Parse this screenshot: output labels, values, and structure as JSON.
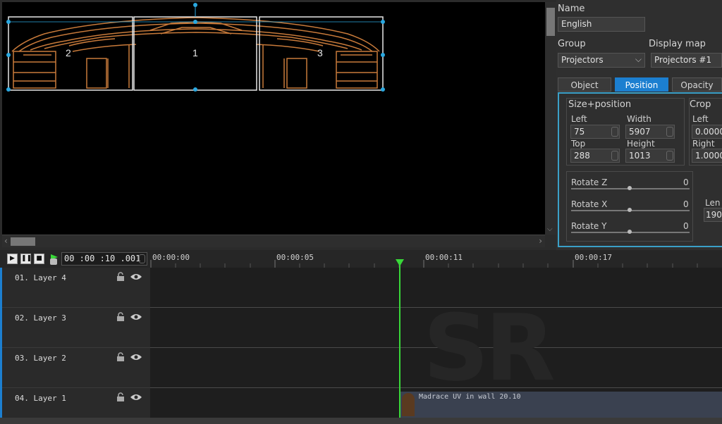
{
  "viewport": {
    "projector_labels": [
      "2",
      "1",
      "3"
    ]
  },
  "properties": {
    "name_label": "Name",
    "name_value": "English",
    "group_label": "Group",
    "group_value": "Projectors",
    "display_map_label": "Display map",
    "display_map_value": "Projectors #1",
    "tabs": [
      {
        "label": "Object",
        "active": false
      },
      {
        "label": "Position",
        "active": true
      },
      {
        "label": "Opacity",
        "active": false
      }
    ],
    "size_position": {
      "title": "Size+position",
      "left_label": "Left",
      "left_value": "75",
      "width_label": "Width",
      "width_value": "5907",
      "top_label": "Top",
      "top_value": "288",
      "height_label": "Height",
      "height_value": "1013"
    },
    "crop": {
      "title": "Crop",
      "left_label": "Left",
      "left_value": "0.0000",
      "right_label": "Right",
      "right_value": "1.0000"
    },
    "rotate": [
      {
        "label": "Rotate Z",
        "value": "0"
      },
      {
        "label": "Rotate X",
        "value": "0"
      },
      {
        "label": "Rotate Y",
        "value": "0"
      }
    ],
    "lens": {
      "label": "Len",
      "value": "190"
    }
  },
  "transport": {
    "play_icon": "play-icon",
    "pause_icon": "pause-icon",
    "stop_icon": "stop-icon",
    "timecode": "00 :00 :10 .001",
    "ruler_labels": [
      "00:00:00",
      "00:00:05",
      "00:00:11",
      "00:00:17"
    ]
  },
  "layers": [
    {
      "name": "01. Layer 4"
    },
    {
      "name": "02. Layer 3"
    },
    {
      "name": "03. Layer 2"
    },
    {
      "name": "04. Layer 1"
    }
  ],
  "clip": {
    "label": "Madrace UV in wall 20.10"
  },
  "watermark": "SR",
  "colors": {
    "accent": "#1c7fd0",
    "playhead": "#39d839",
    "handle": "#2aa8e0",
    "wireframe": "#c87a3a"
  }
}
